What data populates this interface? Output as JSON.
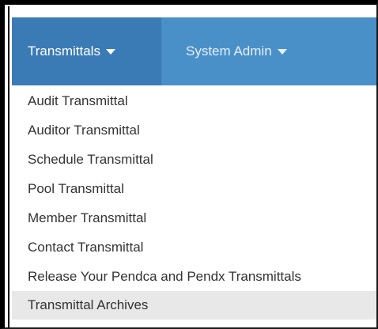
{
  "navbar": {
    "items": [
      {
        "label": "Transmittals",
        "icon": "caret-down-icon",
        "active": true
      },
      {
        "label": "System Admin",
        "icon": "caret-down-icon",
        "active": false
      }
    ]
  },
  "menu": {
    "items": [
      {
        "label": "Audit Transmittal"
      },
      {
        "label": "Auditor Transmittal"
      },
      {
        "label": "Schedule Transmittal"
      },
      {
        "label": "Pool Transmittal"
      },
      {
        "label": "Member Transmittal"
      },
      {
        "label": "Contact Transmittal"
      },
      {
        "label": "Release Your Pendca and Pendx Transmittals"
      },
      {
        "label": "Transmittal Archives",
        "highlighted": true
      }
    ]
  },
  "colors": {
    "navbar_bg": "#4a90c8",
    "active_tab_bg": "#3b7bb5",
    "menu_text": "#333333",
    "highlight_bg": "#e8e8e8"
  }
}
